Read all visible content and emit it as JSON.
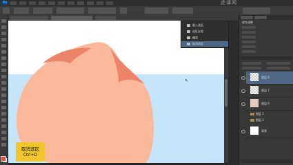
{
  "app": {
    "logo": "Ps",
    "watermark": "虎课网"
  },
  "context_menu": {
    "items": [
      {
        "label": "载入选区"
      },
      {
        "label": "选区反相"
      },
      {
        "label": "编组"
      },
      {
        "label": "取消选区"
      }
    ]
  },
  "panels": {
    "properties_title": "属性调整",
    "layers": [
      {
        "name": "图层 8"
      },
      {
        "name": "图层 7"
      },
      {
        "name": "图层 6"
      }
    ],
    "groups": [
      {
        "name": "图层 1"
      },
      {
        "name": "图层 2"
      }
    ],
    "background_layer": {
      "name": "背景"
    }
  },
  "caption": {
    "title": "取消选区",
    "shortcut": "Ctrl+D"
  },
  "colors": {
    "skin": "#f9b99a",
    "skin_shadow": "#ec8469",
    "sky": "#c6e5fb",
    "caption_bg": "#f1c62d",
    "selected_layer": "#4d6784",
    "foreground_color": "#e34f3a"
  }
}
